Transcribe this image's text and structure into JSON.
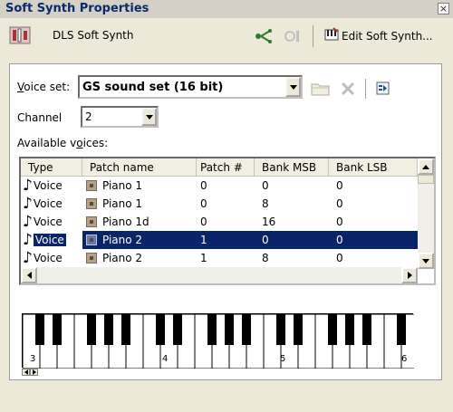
{
  "window": {
    "title": "Soft Synth Properties",
    "close_glyph": "×"
  },
  "toolbar": {
    "synth_name": "DLS Soft Synth",
    "edit_label": "Edit Soft Synth..."
  },
  "voice_set": {
    "label_prefix": "",
    "label_hotkey": "V",
    "label_rest": "oice set:",
    "value": "GS sound set (16 bit)"
  },
  "channel": {
    "label": "Channel",
    "value": "2"
  },
  "voices": {
    "label_pre": "Available v",
    "label_hotkey": "o",
    "label_post": "ices:",
    "columns": [
      "Type",
      "Patch name",
      "Patch #",
      "Bank MSB",
      "Bank LSB"
    ],
    "rows": [
      {
        "type": "Voice",
        "name": "Piano 1",
        "patch": "0",
        "msb": "0",
        "lsb": "0"
      },
      {
        "type": "Voice",
        "name": "Piano 1",
        "patch": "0",
        "msb": "8",
        "lsb": "0"
      },
      {
        "type": "Voice",
        "name": "Piano 1d",
        "patch": "0",
        "msb": "16",
        "lsb": "0"
      },
      {
        "type": "Voice",
        "name": "Piano 2",
        "patch": "1",
        "msb": "0",
        "lsb": "0"
      },
      {
        "type": "Voice",
        "name": "Piano 2",
        "patch": "1",
        "msb": "8",
        "lsb": "0"
      }
    ],
    "selected_row_index": 3
  },
  "keyboard": {
    "octave_labels": [
      "3",
      "4",
      "5",
      "6"
    ]
  },
  "colors": {
    "selection": "#0a246a",
    "title_text": "#0a2a6b",
    "panel_bg": "#ffffff",
    "window_bg": "#ece9d8"
  },
  "icons": {
    "synth": "synth-module-icon",
    "connect": "connect-icon",
    "disabled_tool": "disabled-tool-icon",
    "edit": "edit-synth-icon",
    "folder": "folder-icon",
    "delete": "delete-icon",
    "export": "export-icon",
    "note": "musical-note-icon",
    "patch": "patch-icon"
  }
}
